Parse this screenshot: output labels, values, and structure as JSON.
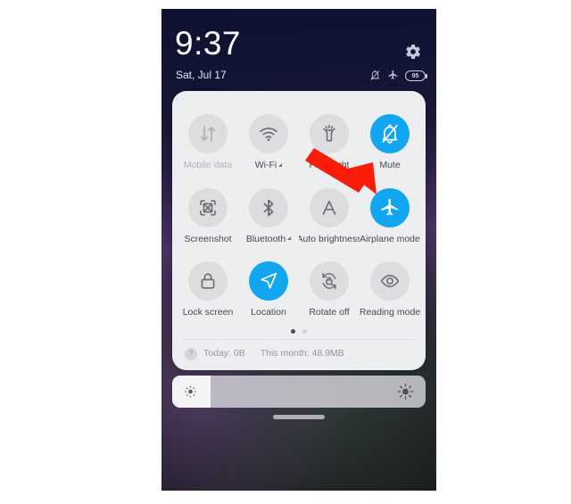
{
  "screen": {
    "clock": "9:37",
    "date": "Sat, Jul 17",
    "battery_level": "95",
    "status_icons": [
      "bell-slash-icon",
      "airplane-icon",
      "battery-icon"
    ],
    "settings_icon": "gear-icon"
  },
  "quick_settings": {
    "tiles": [
      {
        "label": "Mobile data",
        "icon": "mobile-data-icon",
        "active": false,
        "dimmed": true,
        "caret": false
      },
      {
        "label": "Wi-Fi",
        "icon": "wifi-icon",
        "active": false,
        "dimmed": false,
        "caret": true
      },
      {
        "label": "Flashlight",
        "icon": "flashlight-icon",
        "active": false,
        "dimmed": false,
        "caret": false
      },
      {
        "label": "Mute",
        "icon": "bell-slash-icon",
        "active": true,
        "dimmed": false,
        "caret": false
      },
      {
        "label": "Screenshot",
        "icon": "screenshot-icon",
        "active": false,
        "dimmed": false,
        "caret": false
      },
      {
        "label": "Bluetooth",
        "icon": "bluetooth-icon",
        "active": false,
        "dimmed": false,
        "caret": true
      },
      {
        "label": "Auto brightness",
        "icon": "auto-brightness-icon",
        "active": false,
        "dimmed": false,
        "caret": false
      },
      {
        "label": "Airplane mode",
        "icon": "airplane-icon",
        "active": true,
        "dimmed": false,
        "caret": false
      },
      {
        "label": "Lock screen",
        "icon": "lock-icon",
        "active": false,
        "dimmed": false,
        "caret": false
      },
      {
        "label": "Location",
        "icon": "location-arrow-icon",
        "active": true,
        "dimmed": false,
        "caret": false
      },
      {
        "label": "Rotate off",
        "icon": "rotate-lock-icon",
        "active": false,
        "dimmed": false,
        "caret": false
      },
      {
        "label": "Reading mode",
        "icon": "eye-icon",
        "active": false,
        "dimmed": false,
        "caret": false
      }
    ],
    "pages": {
      "count": 2,
      "active_index": 0
    },
    "data_usage": {
      "help_glyph": "?",
      "today": "Today: 0B",
      "month": "This month: 48.9MB"
    }
  },
  "brightness": {
    "level_percent": 15,
    "low_icon": "brightness-low-icon",
    "high_icon": "brightness-high-icon"
  },
  "annotation": {
    "arrow": "red-arrow-pointing-to-airplane-mode",
    "color": "#F91C0A"
  },
  "colors": {
    "accent_blue": "#12A6F0",
    "tile_inactive": "#DCDDDF",
    "card_background": "#ECEEF0",
    "label": "#4A4A4E"
  }
}
